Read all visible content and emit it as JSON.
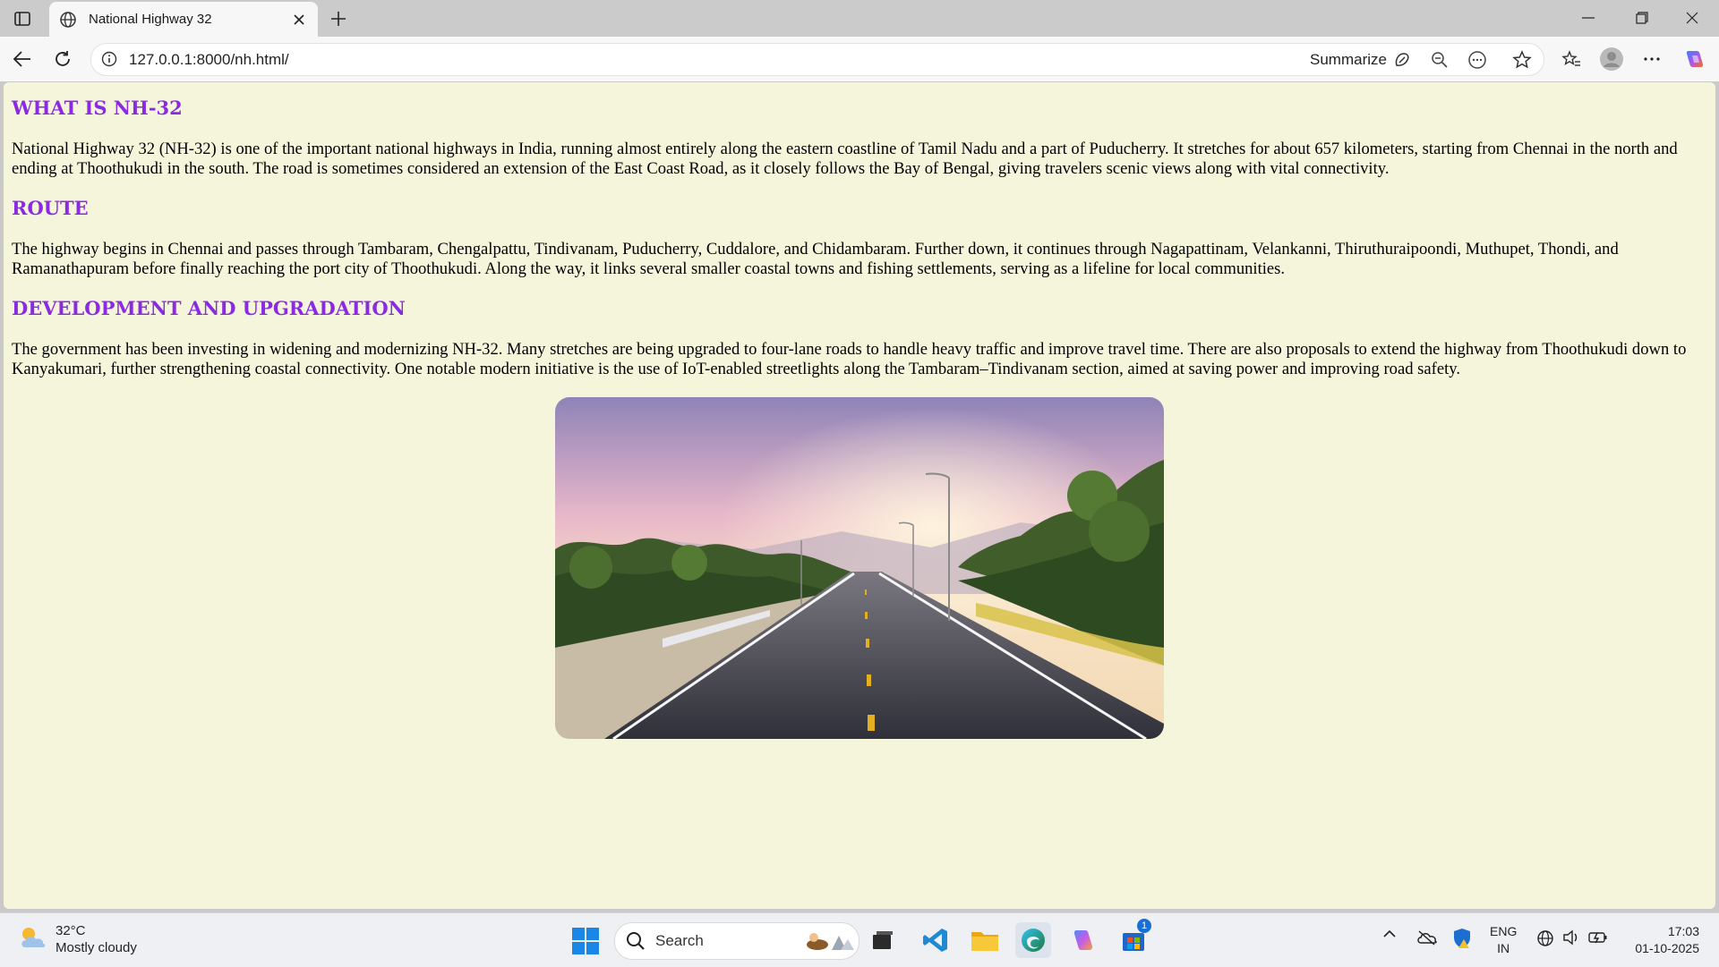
{
  "browser": {
    "tab_title": "National Highway 32",
    "url": "127.0.0.1:8000/nh.html/",
    "summarize_label": "Summarize"
  },
  "page": {
    "sections": [
      {
        "heading": "What is NH-32",
        "body": "National Highway 32 (NH-32) is one of the important national highways in India, running almost entirely along the eastern coastline of Tamil Nadu and a part of Puducherry. It stretches for about 657 kilometers, starting from Chennai in the north and ending at Thoothukudi in the south. The road is sometimes considered an extension of the East Coast Road, as it closely follows the Bay of Bengal, giving travelers scenic views along with vital connectivity."
      },
      {
        "heading": "Route",
        "body": "The highway begins in Chennai and passes through Tambaram, Chengalpattu, Tindivanam, Puducherry, Cuddalore, and Chidambaram. Further down, it continues through Nagapattinam, Velankanni, Thiruthuraipoondi, Muthupet, Thondi, and Ramanathapuram before finally reaching the port city of Thoothukudi. Along the way, it links several smaller coastal towns and fishing settlements, serving as a lifeline for local communities."
      },
      {
        "heading": "Development and Upgradation",
        "body": "The government has been investing in widening and modernizing NH-32. Many stretches are being upgraded to four-lane roads to handle heavy traffic and improve travel time. There are also proposals to extend the highway from Thoothukudi down to Kanyakumari, further strengthening coastal connectivity. One notable modern initiative is the use of IoT-enabled streetlights along the Tambaram–Tindivanam section, aimed at saving power and improving road safety."
      }
    ],
    "heading_color": "#8a2be2",
    "background_color": "#f5f5dc"
  },
  "taskbar": {
    "weather_temp": "32°C",
    "weather_desc": "Mostly cloudy",
    "search_label": "Search",
    "lang_top": "ENG",
    "lang_bottom": "IN",
    "time": "17:03",
    "date": "01-10-2025",
    "store_badge": "1"
  }
}
